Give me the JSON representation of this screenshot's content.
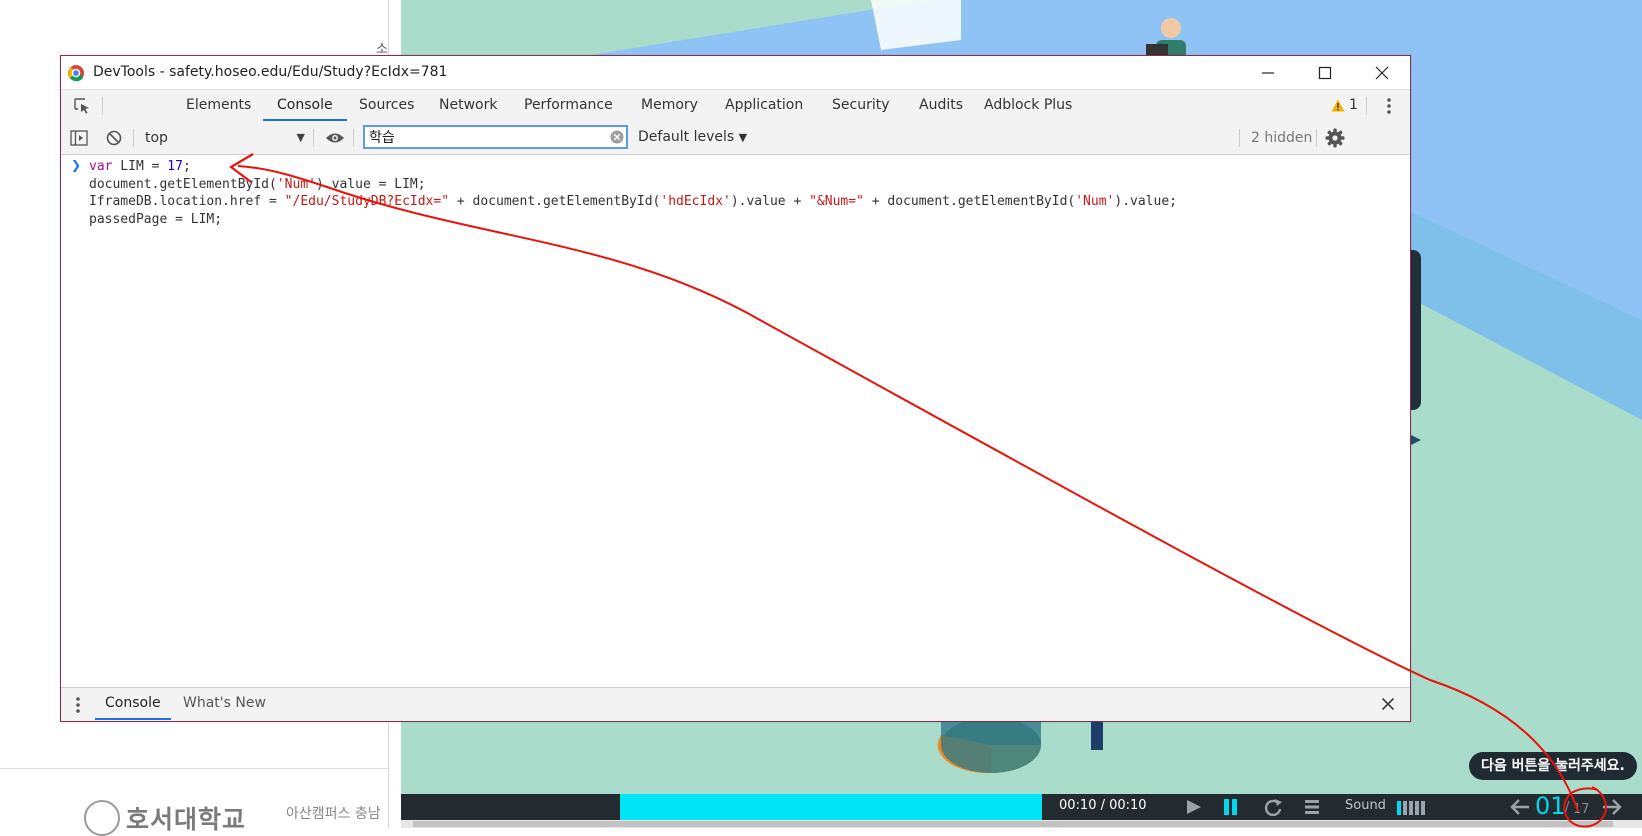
{
  "window": {
    "title": "DevTools - safety.hoseo.edu/Edu/Study?EcIdx=781"
  },
  "tabs": [
    {
      "label": "Elements"
    },
    {
      "label": "Console"
    },
    {
      "label": "Sources"
    },
    {
      "label": "Network"
    },
    {
      "label": "Performance"
    },
    {
      "label": "Memory"
    },
    {
      "label": "Application"
    },
    {
      "label": "Security"
    },
    {
      "label": "Audits"
    },
    {
      "label": "Adblock Plus"
    }
  ],
  "active_tab": "Console",
  "warnings": {
    "count": "1"
  },
  "toolbar": {
    "context": "top",
    "filter_value": "학습",
    "levels": "Default levels",
    "hidden": "2 hidden"
  },
  "console": {
    "lines": [
      [
        {
          "t": "var",
          "c": "kw"
        },
        {
          "t": " LIM = ",
          "c": "var"
        },
        {
          "t": "17",
          "c": "num"
        },
        {
          "t": ";",
          "c": "var"
        }
      ],
      [
        {
          "t": "document.getElementById(",
          "c": "var"
        },
        {
          "t": "'Num'",
          "c": "str"
        },
        {
          "t": ").value = LIM;",
          "c": "var"
        }
      ],
      [
        {
          "t": "IframeDB.location.href = ",
          "c": "var"
        },
        {
          "t": "\"/Edu/StudyDB?EcIdx=\"",
          "c": "str"
        },
        {
          "t": " + document.getElementById(",
          "c": "var"
        },
        {
          "t": "'hdEcIdx'",
          "c": "str"
        },
        {
          "t": ").value + ",
          "c": "var"
        },
        {
          "t": "\"&Num=\"",
          "c": "str"
        },
        {
          "t": " + document.getElementById(",
          "c": "var"
        },
        {
          "t": "'Num'",
          "c": "str"
        },
        {
          "t": ").value;",
          "c": "var"
        }
      ],
      [
        {
          "t": "passedPage = LIM;",
          "c": "var"
        }
      ]
    ]
  },
  "drawer": {
    "tabs": [
      {
        "label": "Console"
      },
      {
        "label": "What's New"
      }
    ]
  },
  "page": {
    "university_name": "호서대학교",
    "campus_text": "아산캠퍼스 충남",
    "top_char": "소",
    "tooltip": "다음 버튼을 눌러주세요.",
    "player": {
      "time": "00:10 / 00:10",
      "sound_label": "Sound",
      "page_current": "01",
      "page_sep": "/",
      "page_total": "17",
      "progress_fill": 0.34
    }
  },
  "colors": {
    "accent": "#1a73e8",
    "progress": "#00e5f5",
    "annotation": "#e8140c",
    "window_border": "#8c2b54"
  }
}
